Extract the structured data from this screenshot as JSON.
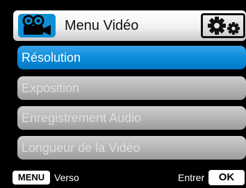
{
  "header": {
    "title": "Menu Vidéo",
    "icon": "video-camera-icon",
    "settings_icon": "gears-icon"
  },
  "menu": {
    "items": [
      {
        "label": "Résolution",
        "selected": true
      },
      {
        "label": "Exposition",
        "selected": false
      },
      {
        "label": "Enregistrement Audio",
        "selected": false
      },
      {
        "label": "Longueur de la Vidéo",
        "selected": false
      }
    ]
  },
  "footer": {
    "menu_key": "MENU",
    "back_label": "Verso",
    "enter_label": "Entrer",
    "ok_key": "OK"
  },
  "colors": {
    "accent": "#0d8fd6",
    "background": "#000000",
    "inactive_item": "#b6b6b6"
  }
}
